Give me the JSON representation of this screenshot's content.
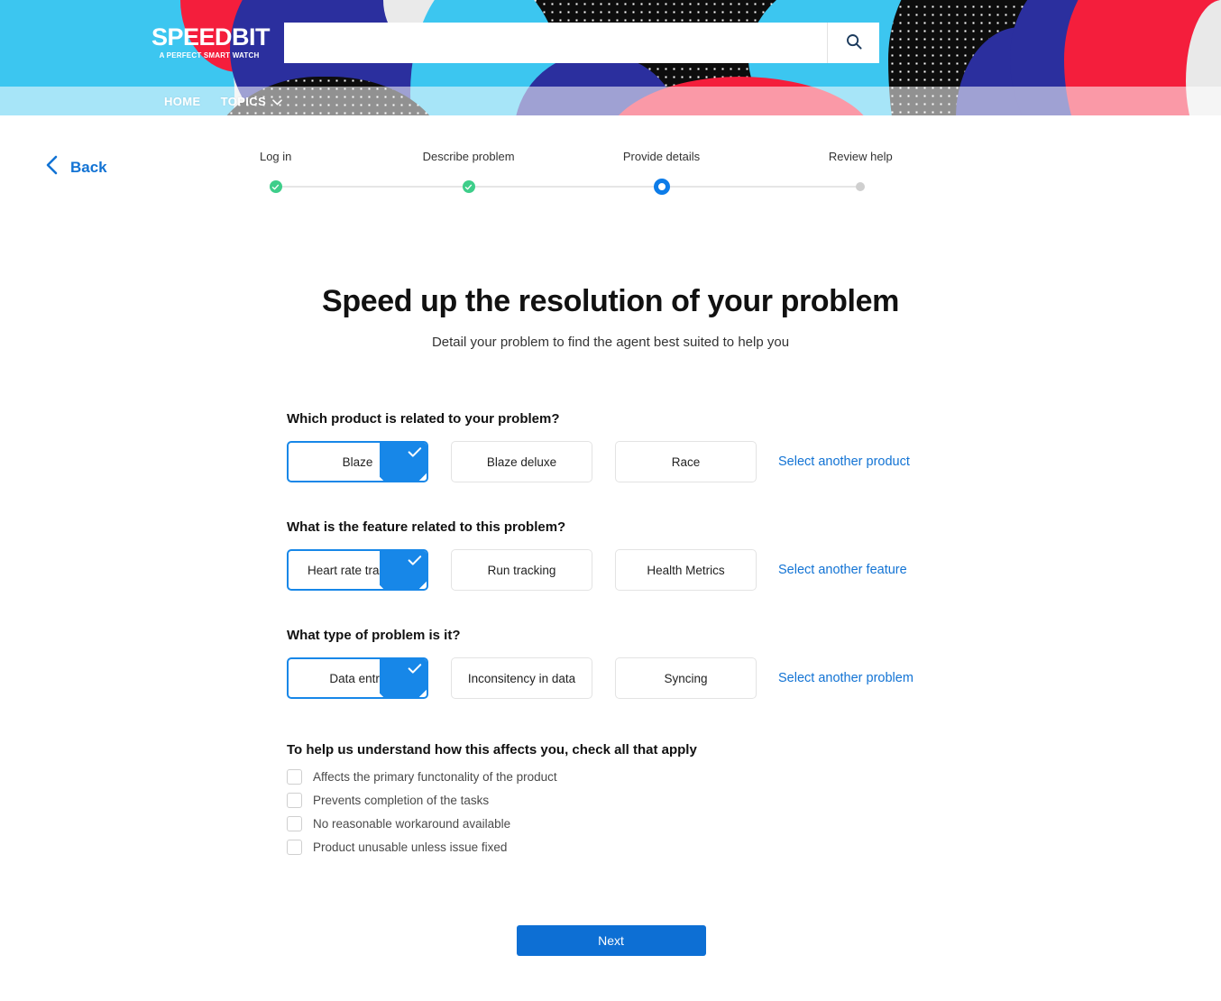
{
  "header": {
    "logo_main": "SPEEDBIT",
    "logo_sub": "A PERFECT SMART WATCH",
    "search_value": "",
    "search_placeholder": "",
    "search_icon": "search-icon",
    "nav": [
      {
        "label": "HOME",
        "has_caret": false
      },
      {
        "label": "TOPICS",
        "has_caret": true
      }
    ]
  },
  "back": {
    "label": "Back",
    "icon": "chevron-left-icon"
  },
  "stepper": {
    "steps": [
      {
        "label": "Log in",
        "state": "done"
      },
      {
        "label": "Describe problem",
        "state": "done"
      },
      {
        "label": "Provide details",
        "state": "active"
      },
      {
        "label": "Review help",
        "state": "todo"
      }
    ]
  },
  "main": {
    "title": "Speed up the resolution of your problem",
    "subtitle": "Detail your problem to find the agent best suited to help you",
    "questions": [
      {
        "title": "Which product is related to your problem?",
        "options": [
          {
            "label": "Blaze",
            "selected": true
          },
          {
            "label": "Blaze deluxe",
            "selected": false
          },
          {
            "label": "Race",
            "selected": false
          }
        ],
        "alt_link": "Select another product"
      },
      {
        "title": "What is the feature related to this problem?",
        "options": [
          {
            "label": "Heart rate tracking",
            "selected": true
          },
          {
            "label": "Run tracking",
            "selected": false
          },
          {
            "label": "Health Metrics",
            "selected": false
          }
        ],
        "alt_link": "Select another feature"
      },
      {
        "title": "What type of problem is it?",
        "options": [
          {
            "label": "Data entry",
            "selected": true
          },
          {
            "label": "Inconsitency in data",
            "selected": false
          },
          {
            "label": "Syncing",
            "selected": false
          }
        ],
        "alt_link": "Select another problem"
      }
    ],
    "checklist": {
      "title": "To help us understand how this affects you, check all that apply",
      "items": [
        {
          "label": "Affects the primary functonality of the product",
          "checked": false
        },
        {
          "label": "Prevents completion of the tasks",
          "checked": false
        },
        {
          "label": "No reasonable workaround available",
          "checked": false
        },
        {
          "label": "Product unusable unless issue fixed",
          "checked": false
        }
      ]
    },
    "next_label": "Next"
  },
  "colors": {
    "accent_blue": "#1787e8",
    "link_blue": "#1273d4",
    "button_blue": "#0d6fd4",
    "step_done_green": "#3ece8a",
    "step_todo_gray": "#cfcfcf",
    "banner_cyan": "#3cc6f0",
    "banner_navy": "#2b2f9e",
    "banner_red": "#f41e3c",
    "banner_black": "#0d0d0d",
    "banner_gray": "#eaeaea"
  }
}
